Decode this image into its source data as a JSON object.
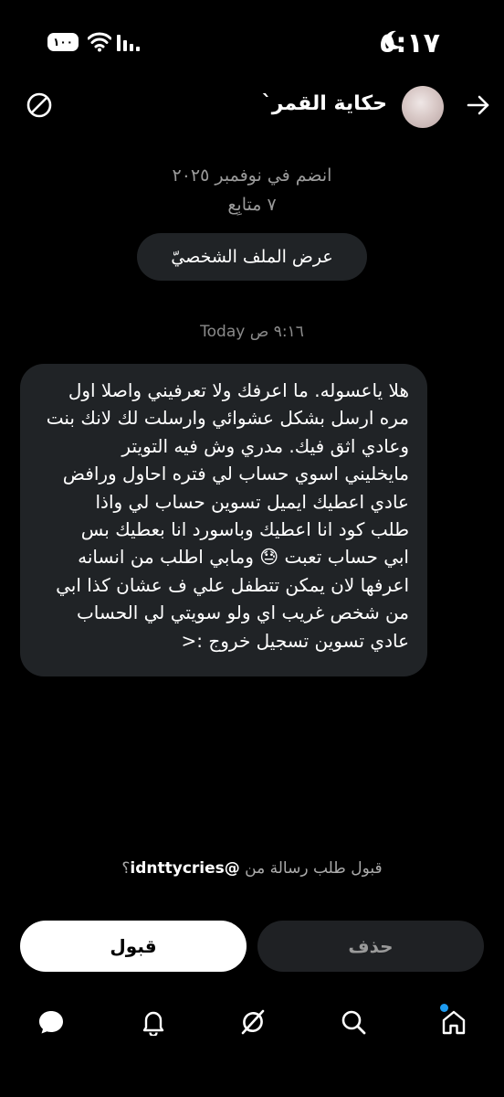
{
  "status_bar": {
    "time": "٥:١٧",
    "battery": "١٠٠"
  },
  "header": {
    "name": "حكاية القمر`"
  },
  "profile": {
    "joined": "انضم في نوفمبر ٢٠٢٥",
    "followers": "٧ متابِع",
    "view_profile_label": "عرض الملف الشخصيّ"
  },
  "message": {
    "timestamp": "Today ٩:١٦ ص",
    "text": "هلا ياعسوله. ما اعرفك ولا تعرفيني واصلا اول\nمره ارسل بشكل عشوائي وارسلت لك لانك بنت\nوعادي اثق فيك. مدري وش فيه التويتر\nمايخليني اسوي حساب لي فتره احاول ورافض\nعادي اعطيك ايميل تسوين حساب لي واذا\nطلب كود انا اعطيك وباسورد انا بعطيك بس\nابي حساب تعبت 😓 ومابي اطلب من انسانه\nاعرفها لان يمكن تتطفل علي ف عشان كذا ابي\nمن شخص غريب اي ولو سويتي لي الحساب\nعادي تسوين تسجيل خروج :<"
  },
  "request": {
    "prefix": "قبول طلب رسالة من ",
    "handle": "@idnttycries",
    "suffix": "؟"
  },
  "actions": {
    "accept_label": "قبول",
    "delete_label": "حذف"
  },
  "nav": {
    "items": [
      "messages-icon",
      "notifications-icon",
      "grok-icon",
      "search-icon",
      "home-icon"
    ]
  },
  "colors": {
    "background": "#000000",
    "surface": "#202326",
    "accent": "#1d9bf0"
  }
}
